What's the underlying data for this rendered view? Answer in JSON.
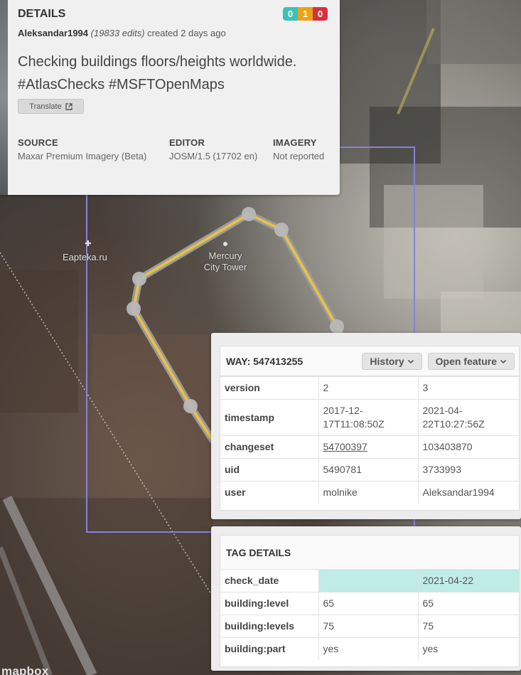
{
  "details": {
    "title": "DETAILS",
    "badges": [
      {
        "value": "0",
        "color": "#3fc1b4"
      },
      {
        "value": "1",
        "color": "#e9a21a"
      },
      {
        "value": "0",
        "color": "#d5323b"
      }
    ],
    "user": "Aleksandar1994",
    "edits": "(19833 edits)",
    "created": "created 2 days ago",
    "comment": "Checking buildings floors/heights worldwide. #AtlasChecks #MSFTOpenMaps",
    "translate_label": "Translate",
    "source_label": "SOURCE",
    "source_value": "Maxar Premium Imagery (Beta)",
    "editor_label": "EDITOR",
    "editor_value": "JOSM/1.5 (17702 en)",
    "imagery_label": "IMAGERY",
    "imagery_value": "Not reported"
  },
  "map": {
    "labels": {
      "eapteka": "Eapteka.ru",
      "mercury_line1": "Mercury",
      "mercury_line2": "City Tower"
    },
    "attribution": "mapbox"
  },
  "way": {
    "title": "WAY: 547413255",
    "history_label": "History",
    "open_feature_label": "Open feature",
    "rows": [
      {
        "key": "version",
        "old": "2",
        "new": "3"
      },
      {
        "key": "timestamp",
        "old": "2017-12-17T11:08:50Z",
        "new": "2021-04-22T10:27:56Z"
      },
      {
        "key": "changeset",
        "old": "54700397",
        "new": "103403870"
      },
      {
        "key": "uid",
        "old": "5490781",
        "new": "3733993"
      },
      {
        "key": "user",
        "old": "molnike",
        "new": "Aleksandar1994"
      }
    ]
  },
  "tags": {
    "title": "TAG DETAILS",
    "rows": [
      {
        "key": "check_date",
        "old": "",
        "new": "2021-04-22"
      },
      {
        "key": "building:level",
        "old": "65",
        "new": "65"
      },
      {
        "key": "building:levels",
        "old": "75",
        "new": "75"
      },
      {
        "key": "building:part",
        "old": "yes",
        "new": "yes"
      }
    ]
  }
}
